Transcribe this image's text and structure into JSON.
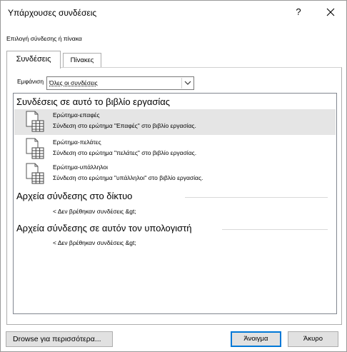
{
  "window": {
    "title": "Υπάρχουσες συνδέσεις",
    "help_label": "?"
  },
  "subtitle": "Επιλογή σύνδεσης ή πίνακα",
  "tabs": [
    {
      "label": "Συνδέσεις",
      "active": true
    },
    {
      "label": "Πίνακες",
      "active": false
    }
  ],
  "show": {
    "label": "Εμφάνιση",
    "value": "Όλες οι συνδέσεις"
  },
  "sections": [
    {
      "title": "Συνδέσεις σε αυτό το βιβλίο εργασίας",
      "items": [
        {
          "name": "Ερώτημα-επαφές",
          "desc": "Σύνδεση στο ερώτημα \"Επαφές\" στο βιβλίο εργασίας.",
          "selected": true,
          "icon": "table-icon"
        },
        {
          "name": "Ερώτημα-πελάτες",
          "desc": "Σύνδεση στο ερώτημα \"πελάτες\" στο βιβλίο εργασίας.",
          "selected": false,
          "icon": "table-icon"
        },
        {
          "name": "Ερώτημα-υπάλληλοι",
          "desc": "Σύνδεση στο ερώτημα \"υπάλληλοι\" στο βιβλίο εργασίας.",
          "selected": false,
          "icon": "table-icon"
        }
      ]
    },
    {
      "title": "Αρχεία σύνδεσης στο δίκτυο",
      "empty_message": "< Δεν βρέθηκαν συνδέσεις &gt;"
    },
    {
      "title": "Αρχεία σύνδεσης σε αυτόν τον υπολογιστή",
      "empty_message": "< Δεν βρέθηκαν συνδέσεις &gt;"
    }
  ],
  "buttons": {
    "browse": "Drowse για περισσότερα...",
    "open": "Άνοιγμα",
    "cancel": "Άκυρο"
  },
  "colors": {
    "selected_row": "#e5e5e5",
    "default_button_border": "#0078d7"
  }
}
